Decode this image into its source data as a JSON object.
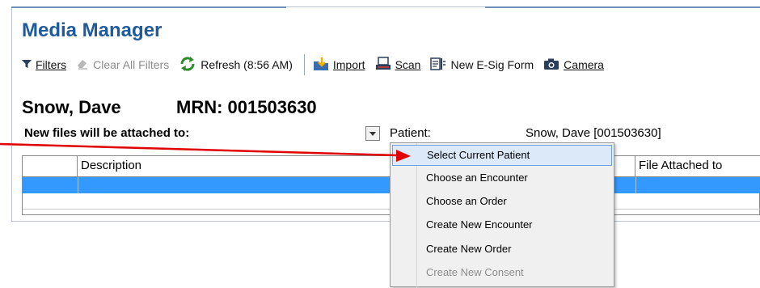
{
  "app": {
    "title": "Media Manager"
  },
  "toolbar": {
    "filters": "Filters",
    "clear_all_filters": "Clear All Filters",
    "refresh": "Refresh (8:56 AM)",
    "import": "Import",
    "scan": "Scan",
    "new_esig_form": "New E-Sig Form",
    "camera": "Camera"
  },
  "patient": {
    "name": "Snow, Dave",
    "mrn": "MRN: 001503630"
  },
  "attach": {
    "label": "New files will be attached to:",
    "field_label": "Patient:",
    "field_value": "Snow, Dave [001503630]"
  },
  "grid": {
    "columns": [
      "",
      "Description",
      "File Attached to"
    ]
  },
  "menu": {
    "items": [
      {
        "label": "Select Current Patient",
        "state": "highlighted"
      },
      {
        "label": "Choose an Encounter",
        "state": "enabled"
      },
      {
        "label": "Choose an Order",
        "state": "enabled"
      },
      {
        "label": "Create New Encounter",
        "state": "enabled"
      },
      {
        "label": "Create New Order",
        "state": "enabled"
      },
      {
        "label": "Create New Consent",
        "state": "disabled"
      }
    ]
  },
  "annotation": {
    "arrow_color": "#e00000"
  },
  "colors": {
    "title": "#1e5a9c",
    "selection": "#3399ff",
    "menu_highlight": "#dbe9f9"
  }
}
